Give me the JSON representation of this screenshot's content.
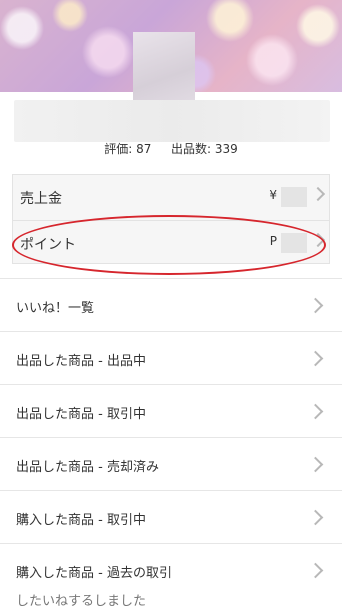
{
  "profile": {
    "stats": {
      "rating_label": "評価:",
      "rating_value": "87",
      "listings_label": "出品数:",
      "listings_value": "339"
    }
  },
  "balance": {
    "sales": {
      "label": "売上金",
      "currency": "¥"
    },
    "points": {
      "label": "ポイント",
      "currency": "P"
    }
  },
  "menu": {
    "items": [
      {
        "label": "いいね！一覧"
      },
      {
        "label": "出品した商品 - 出品中"
      },
      {
        "label": "出品した商品 - 取引中"
      },
      {
        "label": "出品した商品 - 売却済み"
      },
      {
        "label": "購入した商品 - 取引中"
      },
      {
        "label": "購入した商品 - 過去の取引"
      }
    ],
    "cut_off_label": "したいねするしました"
  },
  "icons": {
    "chevron": "chevron-right-icon"
  },
  "colors": {
    "highlight": "#d6262d",
    "chevron": "#b8b8b8",
    "divider": "#e6e6e6",
    "text": "#333333"
  }
}
